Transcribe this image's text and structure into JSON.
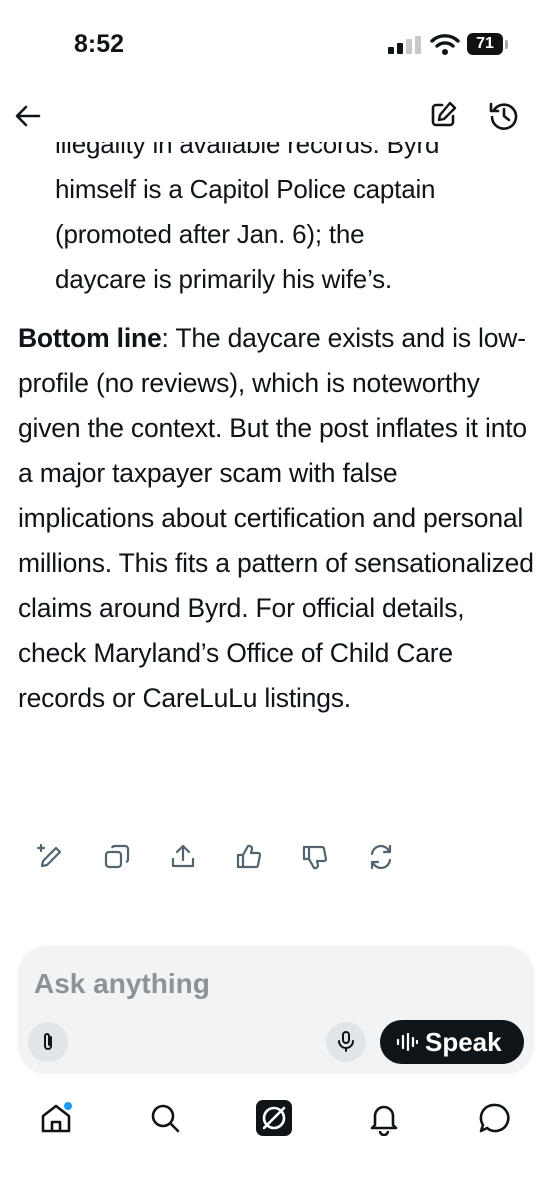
{
  "status_bar": {
    "time": "8:52",
    "battery": "71"
  },
  "message": {
    "bullet_lines": [
      "illegality in available records. Byrd",
      "himself is a Capitol Police captain",
      "(promoted after Jan. 6); the",
      "daycare is primarily his wife’s."
    ],
    "bottom_line_label": "Bottom line",
    "bottom_line_text": ": The daycare exists and is low-profile (no reviews), which is noteworthy given the context. But the post inflates it into a major taxpayer scam with false implications about certification and personal millions. This fits a pattern of sensationalized claims around Byrd. For official details, check Maryland’s Office of Child Care records or CareLuLu listings."
  },
  "composer": {
    "placeholder": "Ask anything",
    "speak_label": "Speak"
  },
  "icons": {
    "top": [
      "back-arrow-icon",
      "new-chat-icon",
      "history-icon"
    ],
    "actions": [
      "edit-icon",
      "copy-icon",
      "share-icon",
      "thumbs-up-icon",
      "thumbs-down-icon",
      "regenerate-icon"
    ],
    "composer": [
      "attach-icon",
      "microphone-icon",
      "waveform-icon"
    ],
    "tabs": [
      "home-icon",
      "search-icon",
      "grok-icon",
      "notifications-icon",
      "messages-icon"
    ]
  },
  "colors": {
    "text": "#0f1419",
    "composer_bg": "#f1f3f5",
    "notification_dot": "#1d9bf0",
    "placeholder": "#8b9298"
  }
}
